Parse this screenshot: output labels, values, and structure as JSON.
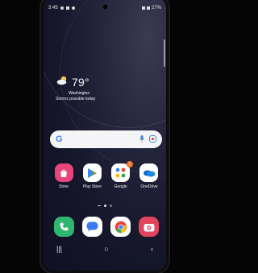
{
  "status_bar": {
    "time": "3:45",
    "battery": "27%"
  },
  "weather": {
    "temperature": "79°",
    "location": "Washington",
    "condition": "Storms possible today",
    "icon": "partly-cloudy-icon"
  },
  "search_bar": {
    "logo": "G",
    "icons": [
      "mic-icon",
      "lens-icon"
    ]
  },
  "home_apps": [
    {
      "label": "Store",
      "icon": "store-icon",
      "color": "#e8457a"
    },
    {
      "label": "Play Store",
      "icon": "play-store-icon",
      "color": "#ffffff"
    },
    {
      "label": "Google",
      "icon": "google-folder-icon",
      "color": "#ffffff",
      "badge": "1"
    },
    {
      "label": "OneDrive",
      "icon": "onedrive-icon",
      "color": "#ffffff"
    }
  ],
  "dock_apps": [
    {
      "icon": "phone-icon",
      "color": "#2fb66f"
    },
    {
      "icon": "messages-icon",
      "color": "#ffffff"
    },
    {
      "icon": "chrome-icon",
      "color": "#ffffff"
    },
    {
      "icon": "camera-icon",
      "color": "#e0455b"
    }
  ],
  "nav_bar": {
    "recents": "|||",
    "home": "○",
    "back": "‹"
  }
}
